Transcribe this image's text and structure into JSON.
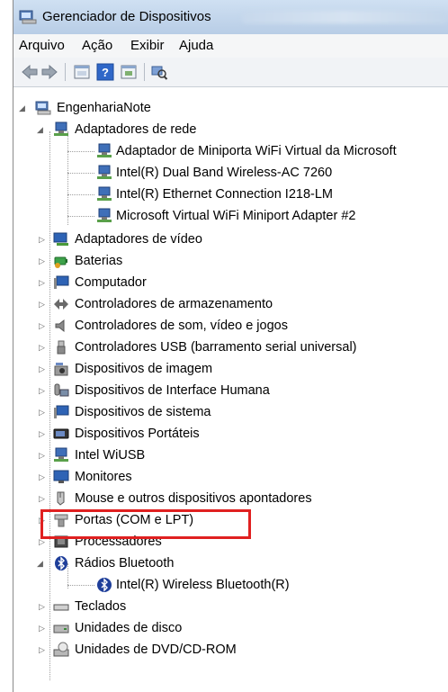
{
  "window": {
    "title": "Gerenciador de Dispositivos"
  },
  "menu": {
    "items": [
      "Arquivo",
      "Ação",
      "Exibir",
      "Ajuda"
    ]
  },
  "tree": {
    "root": "EngenhariaNote",
    "network": {
      "label": "Adaptadores de rede",
      "children": [
        "Adaptador de Miniporta WiFi Virtual da Microsoft",
        "Intel(R) Dual Band Wireless-AC 7260",
        "Intel(R) Ethernet Connection I218-LM",
        "Microsoft Virtual WiFi Miniport Adapter #2"
      ]
    },
    "categories": [
      "Adaptadores de vídeo",
      "Baterias",
      "Computador",
      "Controladores de armazenamento",
      "Controladores de som, vídeo e jogos",
      "Controladores USB (barramento serial universal)",
      "Dispositivos de imagem",
      "Dispositivos de Interface Humana",
      "Dispositivos de sistema",
      "Dispositivos Portáteis",
      "Intel WiUSB",
      "Monitores",
      "Mouse e outros dispositivos apontadores",
      "Portas (COM e LPT)",
      "Processadores"
    ],
    "bluetooth": {
      "label": "Rádios Bluetooth",
      "children": [
        "Intel(R) Wireless Bluetooth(R)"
      ]
    },
    "tail": [
      "Teclados",
      "Unidades de disco",
      "Unidades de DVD/CD-ROM"
    ]
  },
  "colors": {
    "highlight": "#e02020"
  }
}
